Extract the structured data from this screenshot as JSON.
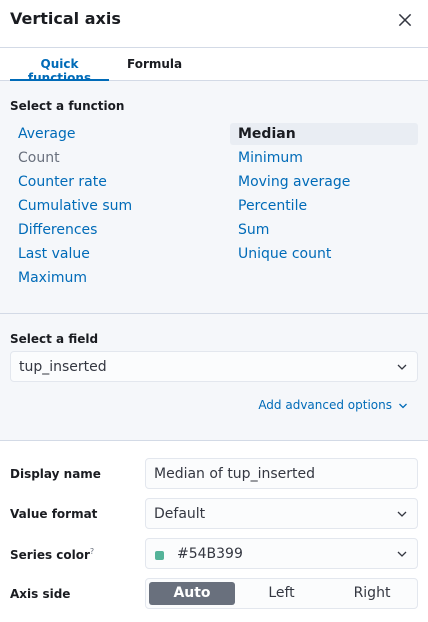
{
  "header": {
    "title": "Vertical axis"
  },
  "tabs": [
    {
      "label": "Quick functions",
      "active": true
    },
    {
      "label": "Formula",
      "active": false
    }
  ],
  "functions": {
    "label": "Select a function",
    "left": [
      "Average",
      "Count",
      "Counter rate",
      "Cumulative sum",
      "Differences",
      "Last value",
      "Maximum"
    ],
    "right": [
      "Median",
      "Minimum",
      "Moving average",
      "Percentile",
      "Sum",
      "Unique count"
    ],
    "selected": "Median",
    "muted": "Count"
  },
  "field": {
    "label": "Select a field",
    "value": "tup_inserted",
    "advanced_label": "Add advanced options"
  },
  "display_name": {
    "label": "Display name",
    "value": "Median of tup_inserted"
  },
  "value_format": {
    "label": "Value format",
    "value": "Default"
  },
  "series_color": {
    "label": "Series color",
    "help": "?",
    "value": "#54B399"
  },
  "axis_side": {
    "label": "Axis side",
    "options": [
      "Auto",
      "Left",
      "Right"
    ],
    "selected": "Auto"
  },
  "colors": {
    "accent": "#006bb8",
    "series": "#54B399",
    "segment_active": "#69707d"
  }
}
